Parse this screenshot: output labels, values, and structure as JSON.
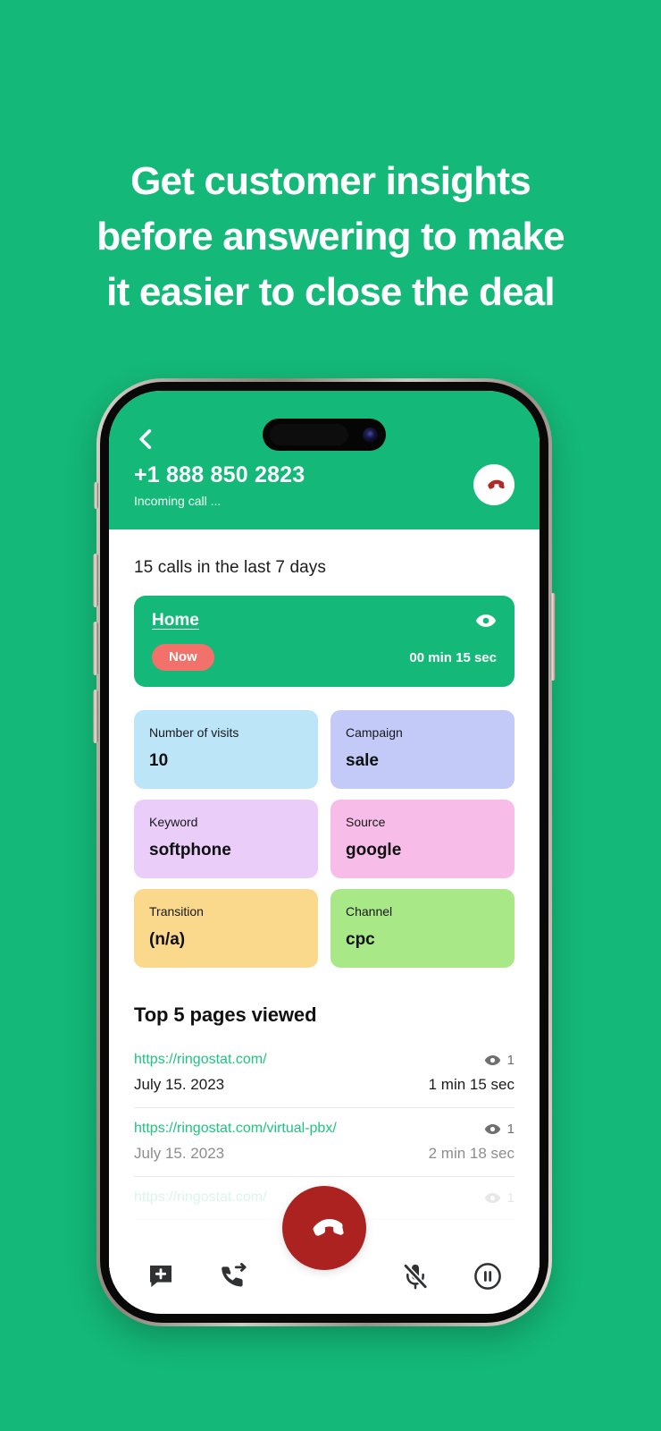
{
  "theme": {
    "background_green": "#14b878",
    "accent_green": "#14b878",
    "link_green": "#1fc47f",
    "badge_red": "#f2716a",
    "hangup_red": "#ab2220",
    "hangup_small_red": "#b02b26"
  },
  "headline": {
    "line1": "Get customer insights",
    "line2": "before answering to make",
    "line3": "it easier to close the deal"
  },
  "app": {
    "header": {
      "back_icon": "chevron-left-icon",
      "caller_number": "+1 888 850 2823",
      "call_status": "Incoming call ...",
      "hangup_icon": "phone-hangup-icon"
    },
    "calls_summary": "15 calls in the last 7 days",
    "session_card": {
      "page_label": "Home",
      "eye_icon": "eye-icon",
      "badge": "Now",
      "duration": "00 min 15 sec"
    },
    "tiles": [
      {
        "label": "Number of visits",
        "value": "10",
        "color": "#bde5f8"
      },
      {
        "label": "Campaign",
        "value": "sale",
        "color": "#c3caf8"
      },
      {
        "label": "Keyword",
        "value": "softphone",
        "color": "#eacdf8"
      },
      {
        "label": "Source",
        "value": "google",
        "color": "#f7bde8"
      },
      {
        "label": "Transition",
        "value": "(n/a)",
        "color": "#fad98c"
      },
      {
        "label": "Channel",
        "value": "cpc",
        "color": "#a9e887"
      }
    ],
    "pages_section": {
      "title": "Top 5 pages viewed",
      "rows": [
        {
          "url": "https://ringostat.com/",
          "views": "1",
          "date": "July 15. 2023",
          "duration": "1 min 15 sec",
          "state": "normal"
        },
        {
          "url": "https://ringostat.com/virtual-pbx/",
          "views": "1",
          "date": "July 15. 2023",
          "duration": "2 min 18 sec",
          "state": "dim"
        },
        {
          "url": "https://ringostat.com/",
          "views": "1",
          "date": "",
          "duration": "",
          "state": "faded"
        }
      ]
    },
    "callbar": {
      "add_note_icon": "message-add-icon",
      "transfer_icon": "call-transfer-icon",
      "hangup_icon": "phone-hangup-icon",
      "mute_icon": "microphone-muted-icon",
      "pause_icon": "pause-circle-icon"
    }
  }
}
